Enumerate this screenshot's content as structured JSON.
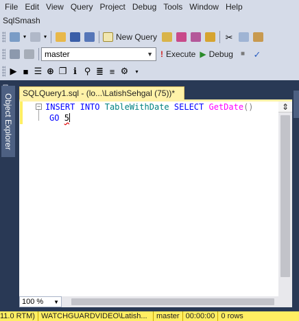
{
  "menu": [
    "File",
    "Edit",
    "View",
    "Query",
    "Project",
    "Debug",
    "Tools",
    "Window",
    "Help"
  ],
  "app_label": "SqlSmash",
  "toolbar_standard": {
    "new_query_label": "New Query"
  },
  "toolbar_sql": {
    "database": "master",
    "execute_label": "Execute",
    "debug_label": "Debug"
  },
  "icons_sqlsmash": [
    "play-icon",
    "stop-icon",
    "list-icon",
    "target-icon",
    "copy-window-icon",
    "info-icon",
    "search-icon",
    "format-icon",
    "format-alt-icon",
    "settings-icon",
    "dropdown-icon"
  ],
  "side_panel": {
    "label": "Object Explorer"
  },
  "document_tab": {
    "label": "SQLQuery1.sql - (lo...\\LatishSehgal (75))*"
  },
  "editor": {
    "line1": {
      "kw1": "INSERT",
      "kw2": "INTO",
      "table": "TableWithDate",
      "kw3": "SELECT",
      "func": "GetDate",
      "paren": "()"
    },
    "line2": {
      "kw": "GO",
      "count": "5"
    }
  },
  "zoom": "100 %",
  "status": {
    "version": "11.0 RTM)",
    "server": "WATCHGUARDVIDEO\\Latish...",
    "database": "master",
    "elapsed": "00:00:00",
    "rows": "0 rows"
  },
  "colors": {
    "chrome": "#d5dbe8",
    "frame": "#293955",
    "active_tab": "#fff2a8",
    "status_bar": "#ffee62",
    "keyword": "#0000ff",
    "identifier": "#008080",
    "function": "#ff00ff"
  }
}
